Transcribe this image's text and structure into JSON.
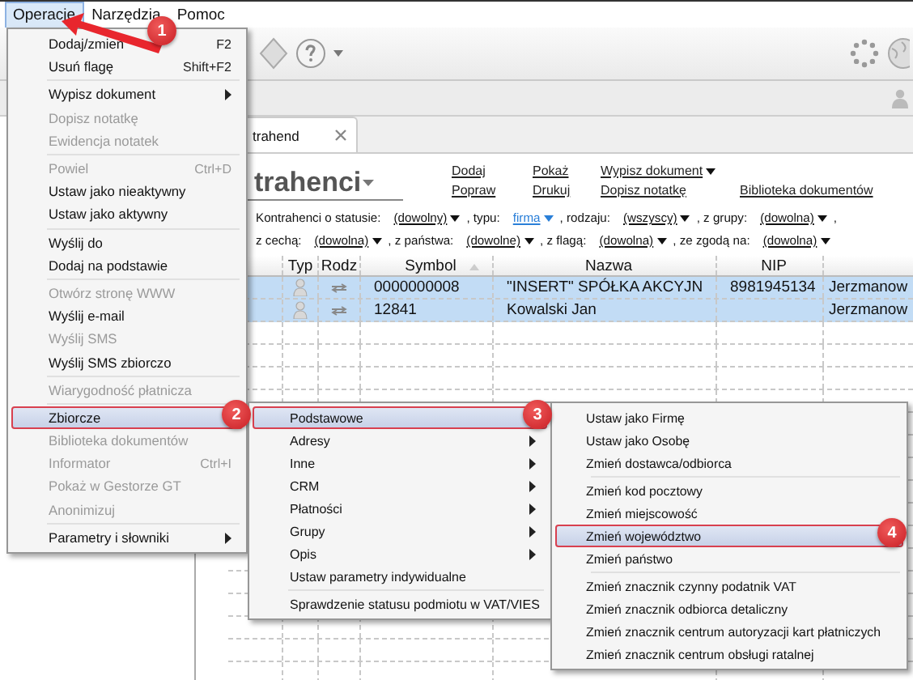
{
  "menubar": [
    {
      "label": "Operacje",
      "selected": true
    },
    {
      "label": "Narzędzia",
      "selected": false
    },
    {
      "label": "Pomoc",
      "selected": false
    }
  ],
  "document_tab": {
    "label": "trahend"
  },
  "title": "trahenci",
  "action_rows": [
    [
      {
        "label": "Dodaj",
        "dropdown": false
      },
      {
        "label": "Pokaż",
        "dropdown": false
      },
      {
        "label": "Wypisz dokument",
        "dropdown": true
      }
    ],
    [
      {
        "label": "Popraw",
        "dropdown": false
      },
      {
        "label": "Drukuj",
        "dropdown": false
      },
      {
        "label": "Dopisz notatkę",
        "dropdown": false
      },
      {
        "label": "Biblioteka dokumentów",
        "dropdown": false
      }
    ]
  ],
  "filter_rows": [
    [
      {
        "label": "Kontrahenci o statusie:",
        "value": "(dowolny)",
        "changed": false
      },
      {
        "label": ", typu:",
        "value": "firma",
        "changed": true
      },
      {
        "label": ", rodzaju:",
        "value": "(wszyscy)",
        "changed": false
      },
      {
        "label": ", z grupy:",
        "value": "(dowolna)",
        "changed": false
      },
      {
        "label": ","
      }
    ],
    [
      {
        "label": "z cechą:",
        "value": "(dowolna)",
        "changed": false
      },
      {
        "label": ", z państwa:",
        "value": "(dowolne)",
        "changed": false
      },
      {
        "label": ", z flagą:",
        "value": "(dowolna)",
        "changed": false
      },
      {
        "label": ", ze zgodą na:",
        "value": "(dowolna)",
        "changed": false
      }
    ]
  ],
  "table": {
    "columns": [
      {
        "label": "Typ"
      },
      {
        "label": "Rodz"
      },
      {
        "label": "Symbol"
      },
      {
        "label": "Nazwa"
      },
      {
        "label": "NIP"
      }
    ],
    "rows": [
      {
        "selected": true,
        "symbol": "0000000008",
        "nazwa": "\"INSERT\" SPÓŁKA AKCYJN",
        "nip": "8981945134",
        "column_7": "Jerzmanow"
      },
      {
        "selected": true,
        "symbol": "12841",
        "nazwa": "Kowalski Jan",
        "column_7": "Jerzmanow"
      }
    ]
  },
  "operacje_menu": [
    {
      "kind": "item",
      "label": "Dodaj/zmień",
      "shortcut": "F2",
      "disabled": false,
      "submenu": false,
      "selected": false
    },
    {
      "kind": "item",
      "label": "Usuń flagę",
      "shortcut": "Shift+F2",
      "disabled": false,
      "submenu": false,
      "selected": false
    },
    {
      "kind": "separator"
    },
    {
      "kind": "item",
      "label": "Wypisz dokument",
      "disabled": false,
      "submenu": true,
      "selected": false
    },
    {
      "kind": "item",
      "label": "Dopisz notatkę",
      "disabled": true,
      "submenu": false,
      "selected": false
    },
    {
      "kind": "item",
      "label": "Ewidencja notatek",
      "disabled": true,
      "submenu": false,
      "selected": false
    },
    {
      "kind": "separator"
    },
    {
      "kind": "item",
      "label": "Powiel",
      "shortcut": "Ctrl+D",
      "disabled": true,
      "submenu": false,
      "selected": false
    },
    {
      "kind": "item",
      "label": "Ustaw jako nieaktywny",
      "disabled": false,
      "submenu": false,
      "selected": false
    },
    {
      "kind": "item",
      "label": "Ustaw jako aktywny",
      "disabled": false,
      "submenu": false,
      "selected": false
    },
    {
      "kind": "separator"
    },
    {
      "kind": "item",
      "label": "Wyślij do",
      "disabled": false,
      "submenu": false,
      "selected": false
    },
    {
      "kind": "item",
      "label": "Dodaj na podstawie",
      "disabled": false,
      "submenu": false,
      "selected": false
    },
    {
      "kind": "separator"
    },
    {
      "kind": "item",
      "label": "Otwórz stronę WWW",
      "disabled": true,
      "submenu": false,
      "selected": false
    },
    {
      "kind": "item",
      "label": "Wyślij e-mail",
      "disabled": false,
      "submenu": false,
      "selected": false
    },
    {
      "kind": "item",
      "label": "Wyślij SMS",
      "disabled": true,
      "submenu": false,
      "selected": false
    },
    {
      "kind": "item",
      "label": "Wyślij SMS zbiorczo",
      "disabled": false,
      "submenu": false,
      "selected": false
    },
    {
      "kind": "separator"
    },
    {
      "kind": "item",
      "label": "Wiarygodność płatnicza",
      "disabled": true,
      "submenu": false,
      "selected": false
    },
    {
      "kind": "separator"
    },
    {
      "kind": "item",
      "label": "Zbiorcze",
      "disabled": false,
      "submenu": false,
      "selected": true
    },
    {
      "kind": "item",
      "label": "Biblioteka dokumentów",
      "disabled": true,
      "submenu": false,
      "selected": false
    },
    {
      "kind": "item",
      "label": "Informator",
      "shortcut": "Ctrl+I",
      "disabled": true,
      "submenu": false,
      "selected": false
    },
    {
      "kind": "item",
      "label": "Pokaż w Gestorze GT",
      "disabled": true,
      "submenu": false,
      "selected": false
    },
    {
      "kind": "item",
      "label": "Anonimizuj",
      "disabled": true,
      "submenu": false,
      "selected": false
    },
    {
      "kind": "separator"
    },
    {
      "kind": "item",
      "label": "Parametry i słowniki",
      "disabled": false,
      "submenu": true,
      "selected": false
    }
  ],
  "zbiorcze_menu": [
    {
      "kind": "item",
      "label": "Podstawowe",
      "disabled": false,
      "submenu": false,
      "selected": true
    },
    {
      "kind": "item",
      "label": "Adresy",
      "disabled": false,
      "submenu": true,
      "selected": false
    },
    {
      "kind": "item",
      "label": "Inne",
      "disabled": false,
      "submenu": true,
      "selected": false
    },
    {
      "kind": "item",
      "label": "CRM",
      "disabled": false,
      "submenu": true,
      "selected": false
    },
    {
      "kind": "item",
      "label": "Płatności",
      "disabled": false,
      "submenu": true,
      "selected": false
    },
    {
      "kind": "item",
      "label": "Grupy",
      "disabled": false,
      "submenu": true,
      "selected": false
    },
    {
      "kind": "item",
      "label": "Opis",
      "disabled": false,
      "submenu": true,
      "selected": false
    },
    {
      "kind": "item",
      "label": "Ustaw parametry indywidualne",
      "disabled": false,
      "submenu": false,
      "selected": false
    },
    {
      "kind": "separator"
    },
    {
      "kind": "item",
      "label": "Sprawdzenie statusu podmiotu w VAT/VIES",
      "disabled": false,
      "submenu": false,
      "selected": false
    }
  ],
  "podstawowe_menu": [
    {
      "kind": "item",
      "label": "Ustaw jako Firmę",
      "disabled": false,
      "submenu": false,
      "selected": false
    },
    {
      "kind": "item",
      "label": "Ustaw jako Osobę",
      "disabled": false,
      "submenu": false,
      "selected": false
    },
    {
      "kind": "item",
      "label": "Zmień dostawca/odbiorca",
      "disabled": false,
      "submenu": false,
      "selected": false
    },
    {
      "kind": "separator"
    },
    {
      "kind": "item",
      "label": "Zmień kod pocztowy",
      "disabled": false,
      "submenu": false,
      "selected": false
    },
    {
      "kind": "item",
      "label": "Zmień miejscowość",
      "disabled": false,
      "submenu": false,
      "selected": false
    },
    {
      "kind": "item",
      "label": "Zmień województwo",
      "disabled": false,
      "submenu": false,
      "selected": true
    },
    {
      "kind": "item",
      "label": "Zmień państwo",
      "disabled": false,
      "submenu": false,
      "selected": false
    },
    {
      "kind": "separator"
    },
    {
      "kind": "item",
      "label": "Zmień znacznik czynny podatnik VAT",
      "disabled": false,
      "submenu": false,
      "selected": false
    },
    {
      "kind": "item",
      "label": "Zmień znacznik odbiorca detaliczny",
      "disabled": false,
      "submenu": false,
      "selected": false
    },
    {
      "kind": "item",
      "label": "Zmień znacznik centrum autoryzacji kart płatniczych",
      "disabled": false,
      "submenu": false,
      "selected": false
    },
    {
      "kind": "item",
      "label": "Zmień znacznik centrum obsługi ratalnej",
      "disabled": false,
      "submenu": false,
      "selected": false
    }
  ],
  "callouts": [
    {
      "label": "1"
    },
    {
      "label": "2"
    },
    {
      "label": "3"
    },
    {
      "label": "4"
    }
  ]
}
